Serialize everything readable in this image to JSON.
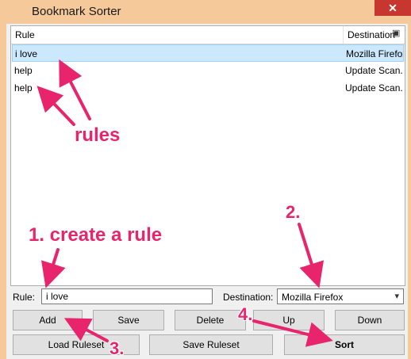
{
  "window": {
    "title": "Bookmark Sorter",
    "close_glyph": "✕"
  },
  "list": {
    "columns": {
      "rule": "Rule",
      "destination": "Destination",
      "menu_icon": "column-chooser-icon"
    },
    "rows": [
      {
        "rule": "i love",
        "destination": "Mozilla Firefox",
        "selected": true
      },
      {
        "rule": "help",
        "destination": "Update Scan...",
        "selected": false
      },
      {
        "rule": "help",
        "destination": "Update Scan...",
        "selected": false
      }
    ]
  },
  "form": {
    "rule_label": "Rule:",
    "rule_value": "i love",
    "destination_label": "Destination:",
    "destination_value": "Mozilla Firefox"
  },
  "buttons": {
    "add": "Add",
    "save": "Save",
    "delete": "Delete",
    "up": "Up",
    "down": "Down",
    "load_ruleset": "Load Ruleset",
    "save_ruleset": "Save Ruleset",
    "sort": "Sort"
  },
  "annotations": {
    "rules": "rules",
    "create_rule": "1. create a rule",
    "step2": "2.",
    "step3": "3.",
    "step4": "4.",
    "color": "#e8256c"
  }
}
